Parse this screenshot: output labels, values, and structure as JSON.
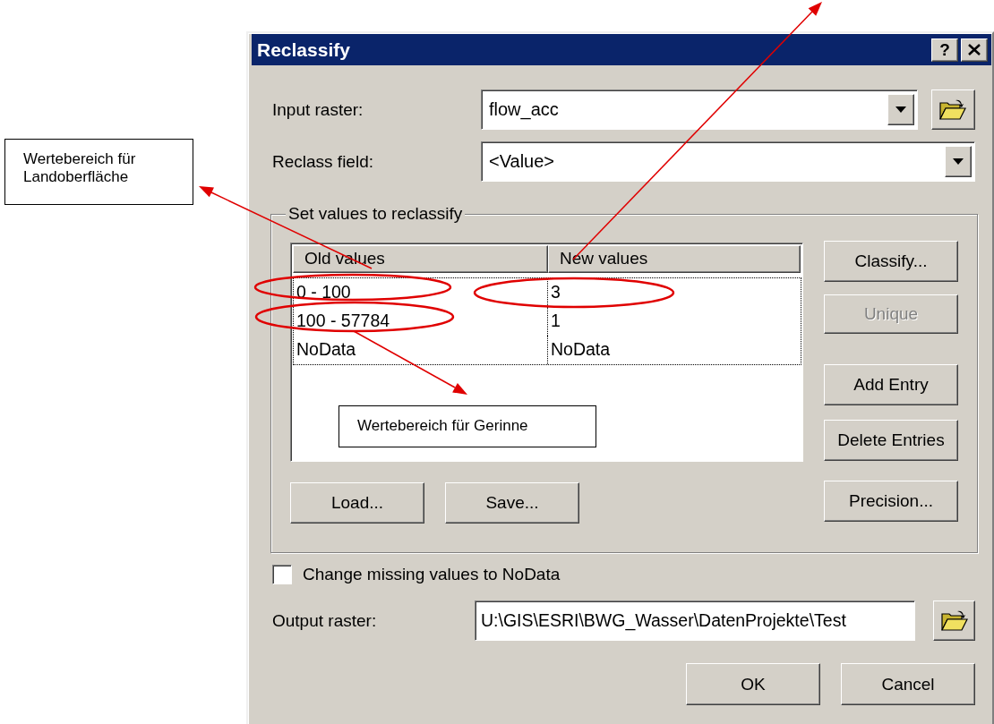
{
  "window": {
    "title": "Reclassify",
    "help_button": "?"
  },
  "input_raster": {
    "label": "Input raster:",
    "value": "flow_acc"
  },
  "reclass_field": {
    "label": "Reclass field:",
    "value": "<Value>"
  },
  "reclass_group": {
    "legend": "Set values to reclassify",
    "table": {
      "columns": [
        "Old values",
        "New values"
      ],
      "rows": [
        [
          "0 - 100",
          "3"
        ],
        [
          "100 - 57784",
          "1"
        ],
        [
          "NoData",
          "NoData"
        ]
      ]
    },
    "side_buttons": [
      {
        "label": "Classify...",
        "disabled": false
      },
      {
        "label": "Unique",
        "disabled": true
      },
      {
        "label": "Add Entry",
        "disabled": false
      },
      {
        "label": "Delete Entries",
        "disabled": false
      },
      {
        "label": "Precision...",
        "disabled": false
      }
    ],
    "bottom_buttons": [
      "Load...",
      "Save..."
    ]
  },
  "missing_values": {
    "label": "Change missing values to NoData",
    "checked": false
  },
  "output_raster": {
    "label": "Output raster:",
    "value": "U:\\GIS\\ESRI\\BWG_Wasser\\DatenProjekte\\Test"
  },
  "buttons": [
    "OK",
    "Cancel"
  ],
  "annotations": [
    {
      "text": "Wertebereich für Landoberfläche"
    },
    {
      "text": "Wertebereich für Gerinne"
    }
  ]
}
